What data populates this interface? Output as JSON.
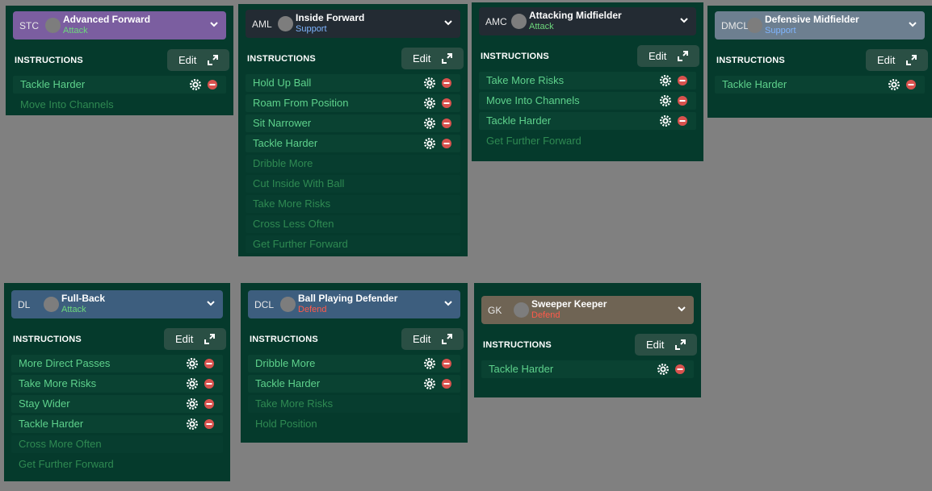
{
  "ui": {
    "instructions_label": "INSTRUCTIONS",
    "edit_label": "Edit"
  },
  "colors": {
    "attack": "#6dd87c",
    "support": "#7fb5ff",
    "defend": "#ff5a4a",
    "header_purple": "#7b5ea0",
    "header_dark": "#232b33",
    "header_steel": "#6d7f90",
    "header_blue": "#3d5e7e",
    "header_brown": "#6f6454",
    "remove_red": "#d9524e",
    "card_bg": "#053a2c"
  },
  "cards": [
    {
      "position": "STC",
      "role": "Advanced Forward",
      "duty": "Attack",
      "items": [
        {
          "label": "Tackle Harder",
          "active": true
        },
        {
          "label": "Move Into Channels",
          "active": false
        }
      ]
    },
    {
      "position": "AML",
      "role": "Inside Forward",
      "duty": "Support",
      "items": [
        {
          "label": "Hold Up Ball",
          "active": true
        },
        {
          "label": "Roam From Position",
          "active": true
        },
        {
          "label": "Sit Narrower",
          "active": true
        },
        {
          "label": "Tackle Harder",
          "active": true
        },
        {
          "label": "Dribble More",
          "active": false
        },
        {
          "label": "Cut Inside With Ball",
          "active": false
        },
        {
          "label": "Take More Risks",
          "active": false
        },
        {
          "label": "Cross Less Often",
          "active": false
        },
        {
          "label": "Get Further Forward",
          "active": false
        }
      ]
    },
    {
      "position": "AMC",
      "role": "Attacking Midfielder",
      "duty": "Attack",
      "items": [
        {
          "label": "Take More Risks",
          "active": true
        },
        {
          "label": "Move Into Channels",
          "active": true
        },
        {
          "label": "Tackle Harder",
          "active": true
        },
        {
          "label": "Get Further Forward",
          "active": false
        }
      ]
    },
    {
      "position": "DMCL",
      "role": "Defensive Midfielder",
      "duty": "Support",
      "items": [
        {
          "label": "Tackle Harder",
          "active": true
        }
      ]
    },
    {
      "position": "DL",
      "role": "Full-Back",
      "duty": "Attack",
      "items": [
        {
          "label": "More Direct Passes",
          "active": true
        },
        {
          "label": "Take More Risks",
          "active": true
        },
        {
          "label": "Stay Wider",
          "active": true
        },
        {
          "label": "Tackle Harder",
          "active": true
        },
        {
          "label": "Cross More Often",
          "active": false
        },
        {
          "label": "Get Further Forward",
          "active": false
        }
      ]
    },
    {
      "position": "DCL",
      "role": "Ball Playing Defender",
      "duty": "Defend",
      "items": [
        {
          "label": "Dribble More",
          "active": true
        },
        {
          "label": "Tackle Harder",
          "active": true
        },
        {
          "label": "Take More Risks",
          "active": false
        },
        {
          "label": "Hold Position",
          "active": false
        }
      ]
    },
    {
      "position": "GK",
      "role": "Sweeper Keeper",
      "duty": "Defend",
      "items": [
        {
          "label": "Tackle Harder",
          "active": true
        }
      ]
    }
  ]
}
